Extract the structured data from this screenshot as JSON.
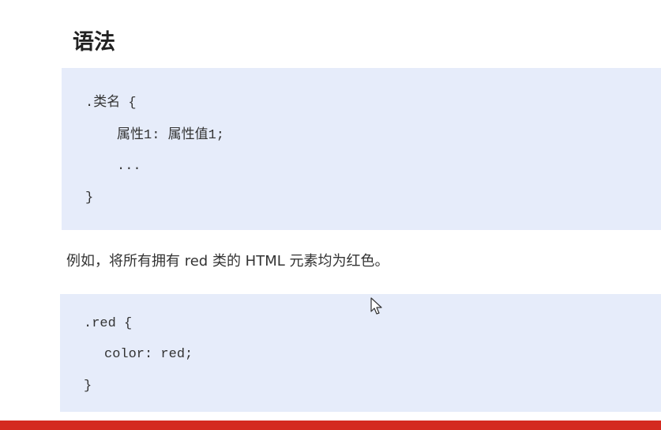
{
  "heading": "语法",
  "syntax_code": {
    "line1": ".类名 {",
    "line2": "属性1: 属性值1;",
    "line3": "...",
    "line4": "}"
  },
  "example_text": "例如，将所有拥有 red 类的 HTML 元素均为红色。",
  "example_code": {
    "line1": ".red {",
    "line2": "color: red;",
    "line3": "}"
  },
  "icons": {
    "cursor": "mouse-pointer-icon"
  },
  "colors": {
    "code_background": "#e6ecfa",
    "bottom_bar": "#d42a20",
    "heading_text": "#222222",
    "body_text": "#333333"
  }
}
